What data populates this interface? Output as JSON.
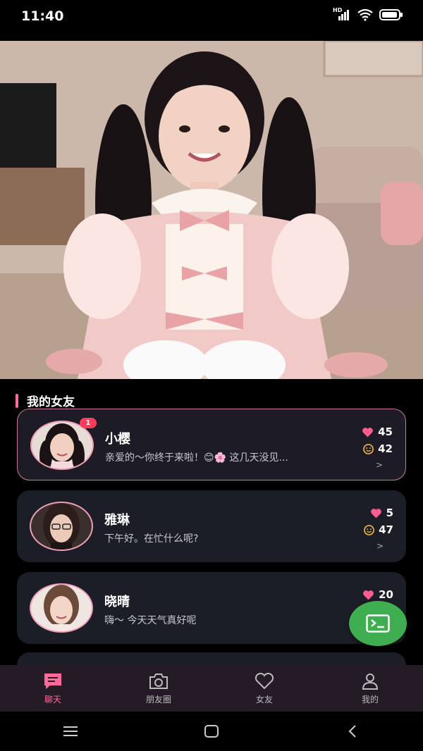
{
  "status_bar": {
    "time": "11:40",
    "hd_label": "HD"
  },
  "section": {
    "title": "我的女友"
  },
  "girlfriends": [
    {
      "name": "小樱",
      "message": "亲爱的～你终于来啦！😊🌸 这几天没见...",
      "likes": "45",
      "mood": "42",
      "badge": "1",
      "active": true
    },
    {
      "name": "雅琳",
      "message": "下午好。在忙什么呢?",
      "likes": "5",
      "mood": "47",
      "active": false
    },
    {
      "name": "晓晴",
      "message": "嗨～ 今天天气真好呢",
      "likes": "20",
      "active": false
    }
  ],
  "tabs": [
    {
      "label": "聊天",
      "icon": "chat-icon",
      "active": true
    },
    {
      "label": "朋友圈",
      "icon": "camera-icon",
      "active": false
    },
    {
      "label": "女友",
      "icon": "heart-icon",
      "active": false
    },
    {
      "label": "我的",
      "icon": "person-icon",
      "active": false
    }
  ],
  "colors": {
    "accent": "#ff6a9a",
    "fab": "#3fae50",
    "card": "#1b1d27",
    "tab_bar": "#241b26"
  }
}
